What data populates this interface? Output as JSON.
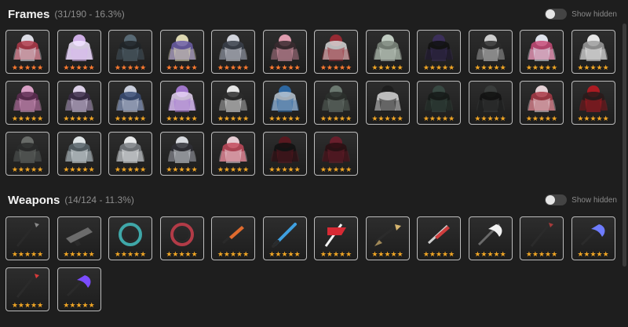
{
  "frames": {
    "title": "Frames",
    "count": "(31/190 - 16.3%)",
    "toggle_label": "Show hidden",
    "items": [
      {
        "name": "frame-1",
        "stars": "★★★★★",
        "star_color": "#ff7a2f",
        "c1": "#e6e6ef",
        "c2": "#b03a4a"
      },
      {
        "name": "frame-2",
        "stars": "★★★★★",
        "star_color": "#ff7a2f",
        "c1": "#d8b6f0",
        "c2": "#f2e6ff"
      },
      {
        "name": "frame-3",
        "stars": "★★★★★",
        "star_color": "#ff7a2f",
        "c1": "#5b6d78",
        "c2": "#202428"
      },
      {
        "name": "frame-4",
        "stars": "★★★★★",
        "star_color": "#ff7a2f",
        "c1": "#e7e2b9",
        "c2": "#6c5ea8"
      },
      {
        "name": "frame-5",
        "stars": "★★★★★",
        "star_color": "#ff7a2f",
        "c1": "#dadde6",
        "c2": "#3a3f4a"
      },
      {
        "name": "frame-6",
        "stars": "★★★★★",
        "star_color": "#ff7a2f",
        "c1": "#e9a2b5",
        "c2": "#3a2a2f"
      },
      {
        "name": "frame-7",
        "stars": "★★★★★",
        "star_color": "#ff7a2f",
        "c1": "#9c2a34",
        "c2": "#d6d6d6"
      },
      {
        "name": "frame-8",
        "stars": "★★★★★",
        "star_color": "#f0a524",
        "c1": "#c8d4c9",
        "c2": "#7f8a7f"
      },
      {
        "name": "frame-9",
        "stars": "★★★★★",
        "star_color": "#f0a524",
        "c1": "#3c2f5c",
        "c2": "#111"
      },
      {
        "name": "frame-10",
        "stars": "★★★★★",
        "star_color": "#f0a524",
        "c1": "#d6d6d6",
        "c2": "#2b2b2b"
      },
      {
        "name": "frame-11",
        "stars": "★★★★★",
        "star_color": "#f0a524",
        "c1": "#e9edf7",
        "c2": "#c84b78"
      },
      {
        "name": "frame-12",
        "stars": "★★★★★",
        "star_color": "#f0a524",
        "c1": "#f0f0f0",
        "c2": "#9e9e9e"
      },
      {
        "name": "frame-13",
        "stars": "★★★★★",
        "star_color": "#f0a524",
        "c1": "#e2a6ce",
        "c2": "#5e2d52"
      },
      {
        "name": "frame-14",
        "stars": "★★★★★",
        "star_color": "#f0a524",
        "c1": "#e6d9f2",
        "c2": "#3a2a46"
      },
      {
        "name": "frame-15",
        "stars": "★★★★★",
        "star_color": "#f0a524",
        "c1": "#d2d7e6",
        "c2": "#3a4c74"
      },
      {
        "name": "frame-16",
        "stars": "★★★★★",
        "star_color": "#f0a524",
        "c1": "#a77ad4",
        "c2": "#e6d5f5"
      },
      {
        "name": "frame-17",
        "stars": "★★★★★",
        "star_color": "#f0a524",
        "c1": "#f0f0f0",
        "c2": "#2c2c2c"
      },
      {
        "name": "frame-18",
        "stars": "★★★★★",
        "star_color": "#f0a524",
        "c1": "#2d6aa8",
        "c2": "#b9c6d2"
      },
      {
        "name": "frame-19",
        "stars": "★★★★★",
        "star_color": "#f0a524",
        "c1": "#6f7c74",
        "c2": "#2b302d"
      },
      {
        "name": "frame-20",
        "stars": "★★★★★",
        "star_color": "#f0a524",
        "c1": "#1e1e1e",
        "c2": "#d7d7d7"
      },
      {
        "name": "frame-21",
        "stars": "★★★★★",
        "star_color": "#f0a524",
        "c1": "#394a43",
        "c2": "#151a18"
      },
      {
        "name": "frame-22",
        "stars": "★★★★★",
        "star_color": "#f0a524",
        "c1": "#3a3d3c",
        "c2": "#111"
      },
      {
        "name": "frame-23",
        "stars": "★★★★★",
        "star_color": "#f0a524",
        "c1": "#f0dbe0",
        "c2": "#a83a46"
      },
      {
        "name": "frame-24",
        "stars": "★★★★★",
        "star_color": "#f0a524",
        "c1": "#b21a22",
        "c2": "#2a1a1a"
      },
      {
        "name": "frame-25",
        "stars": "★★★★★",
        "star_color": "#f0a524",
        "c1": "#6b6f6c",
        "c2": "#2a2b2b"
      },
      {
        "name": "frame-26",
        "stars": "★★★★★",
        "star_color": "#f0a524",
        "c1": "#e8eef0",
        "c2": "#58646a"
      },
      {
        "name": "frame-27",
        "stars": "★★★★★",
        "star_color": "#f0a524",
        "c1": "#f1f3f4",
        "c2": "#7a7f84"
      },
      {
        "name": "frame-28",
        "stars": "★★★★★",
        "star_color": "#f0a524",
        "c1": "#dfe3e8",
        "c2": "#2e2e35"
      },
      {
        "name": "frame-29",
        "stars": "★★★★★",
        "star_color": "#f0a524",
        "c1": "#f0d5dc",
        "c2": "#c24a5c"
      },
      {
        "name": "frame-30",
        "stars": "★★★★★",
        "star_color": "#f0a524",
        "c1": "#5b1820",
        "c2": "#111"
      },
      {
        "name": "frame-31",
        "stars": "★★★★★",
        "star_color": "#f0a524",
        "c1": "#6b1f2c",
        "c2": "#2a0e12"
      }
    ]
  },
  "weapons": {
    "title": "Weapons",
    "count": "(14/124 - 11.3%)",
    "toggle_label": "Show hidden",
    "items": [
      {
        "name": "weapon-1",
        "stars": "★★★★★",
        "star_color": "#f0a524",
        "c1": "#8a8a8a",
        "c2": "#2a2a2a",
        "shape": "spear"
      },
      {
        "name": "weapon-2",
        "stars": "★★★★★",
        "star_color": "#f0a524",
        "c1": "#6b6b6b",
        "c2": "#2b2b2b",
        "shape": "gun"
      },
      {
        "name": "weapon-3",
        "stars": "★★★★★",
        "star_color": "#f0a524",
        "c1": "#3fa7a8",
        "c2": "#2b2b2b",
        "shape": "ring"
      },
      {
        "name": "weapon-4",
        "stars": "★★★★★",
        "star_color": "#f0a524",
        "c1": "#b23b47",
        "c2": "#2b2b2b",
        "shape": "ring"
      },
      {
        "name": "weapon-5",
        "stars": "★★★★★",
        "star_color": "#f0a524",
        "c1": "#e06b2e",
        "c2": "#2b2b2b",
        "shape": "blade"
      },
      {
        "name": "weapon-6",
        "stars": "★★★★★",
        "star_color": "#f0a524",
        "c1": "#3fa0e0",
        "c2": "#2b2b2b",
        "shape": "sword"
      },
      {
        "name": "weapon-7",
        "stars": "★★★★★",
        "star_color": "#f0a524",
        "c1": "#d72a34",
        "c2": "#f2f2f2",
        "shape": "flag"
      },
      {
        "name": "weapon-8",
        "stars": "★★★★★",
        "star_color": "#f0a524",
        "c1": "#d6b56f",
        "c2": "#2b2b2b",
        "shape": "arrow"
      },
      {
        "name": "weapon-9",
        "stars": "★★★★★",
        "star_color": "#f0a524",
        "c1": "#cf3d3d",
        "c2": "#e2e2e2",
        "shape": "blade"
      },
      {
        "name": "weapon-10",
        "stars": "★★★★★",
        "star_color": "#f0a524",
        "c1": "#f2f2f2",
        "c2": "#6a6a6a",
        "shape": "scythe"
      },
      {
        "name": "weapon-11",
        "stars": "★★★★★",
        "star_color": "#f0a524",
        "c1": "#a63a3a",
        "c2": "#2b2b2b",
        "shape": "spear"
      },
      {
        "name": "weapon-12",
        "stars": "★★★★★",
        "star_color": "#f0a524",
        "c1": "#6e7cff",
        "c2": "#2b2b2b",
        "shape": "scythe"
      },
      {
        "name": "weapon-13",
        "stars": "★★★★★",
        "star_color": "#f0a524",
        "c1": "#d83a3a",
        "c2": "#2b2b2b",
        "shape": "spear"
      },
      {
        "name": "weapon-14",
        "stars": "★★★★★",
        "star_color": "#f0a524",
        "c1": "#7b4cff",
        "c2": "#2b2b2b",
        "shape": "scythe"
      }
    ]
  }
}
